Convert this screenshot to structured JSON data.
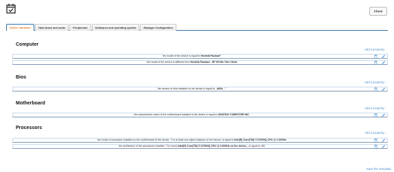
{
  "header": {
    "close_label": "Close"
  },
  "tabs": [
    {
      "label": "Device hardware",
      "active": true
    },
    {
      "label": "Hard disks and cards"
    },
    {
      "label": "Peripherals"
    },
    {
      "label": "Softwares and operating system"
    },
    {
      "label": "Manager Configuration"
    }
  ],
  "add_property_label": "Add a property...",
  "save_template_label": "Save the Template",
  "sections": [
    {
      "title": "Computer",
      "rows": [
        {
          "prefix": "the model of the device ",
          "op": "is equal to",
          "value": "Hewlett-Packard\"",
          "suffix": ""
        },
        {
          "prefix": "the model of the device ",
          "op": "is different from",
          "value": "Hewlett-Packard - HP t5740e Thin Client",
          "suffix": ""
        }
      ]
    },
    {
      "title": "Bios",
      "rows": [
        {
          "prefix": "the version of bios installed on the device ",
          "op": "is equal to",
          "value": "_A60b_ \"",
          "suffix": ""
        }
      ]
    },
    {
      "title": "Motherboard",
      "rows": [
        {
          "prefix": "the manufacturer name of the motherboard installed in the device ",
          "op": "is equal to",
          "value": "ASUSTeK COMPUTER INC.",
          "suffix": ""
        }
      ]
    },
    {
      "title": "Processors",
      "rows": [
        {
          "prefix": "the model of processor installed on the motherboard of the device , For at least one object instance on the device, ",
          "op": "is equal to",
          "value": "Intel(R) Core(TM) i7-6700HQ CPU @ 2.60GHz",
          "suffix": ""
        },
        {
          "prefix": "the achitecture of the processors installed , For every ",
          "op": "",
          "value": "Intel(R) Core(TM) i7-6700HQ CPU @ 2.60GHz on the device, ,",
          "suffix": " is equal to x86"
        }
      ]
    }
  ]
}
